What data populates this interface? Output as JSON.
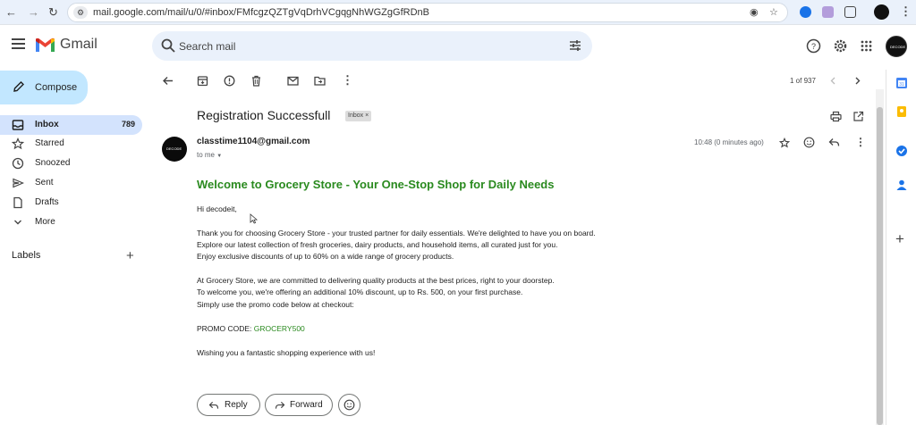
{
  "browser": {
    "url": "mail.google.com/mail/u/0/#inbox/FMfcgzQZTgVqDrhVCgqgNhWGZgGfRDnB"
  },
  "app": {
    "name": "Gmail"
  },
  "search": {
    "placeholder": "Search mail"
  },
  "compose": {
    "label": "Compose"
  },
  "sidebar": {
    "items": [
      {
        "label": "Inbox",
        "count": "789",
        "icon": "inbox-icon"
      },
      {
        "label": "Starred",
        "icon": "star-icon"
      },
      {
        "label": "Snoozed",
        "icon": "clock-icon"
      },
      {
        "label": "Sent",
        "icon": "send-icon"
      },
      {
        "label": "Drafts",
        "icon": "draft-icon"
      },
      {
        "label": "More",
        "icon": "chevron-down-icon"
      }
    ],
    "labels_heading": "Labels"
  },
  "toolbar": {
    "pager": "1 of 937"
  },
  "message": {
    "subject": "Registration Successfull",
    "label_chip": "Inbox ×",
    "avatar_text": "DECODE",
    "sender": "classtime1104@gmail.com",
    "to": "to me",
    "time": "10:48 (0 minutes ago)",
    "heading": "Welcome to Grocery Store - Your One-Stop Shop for Daily Needs",
    "greeting": "Hi decodeit,",
    "p1_l1": "Thank you for choosing Grocery Store - your trusted partner for daily essentials. We're delighted to have you on board.",
    "p1_l2": "Explore our latest collection of fresh groceries, dairy products, and household items, all curated just for you.",
    "p1_l3": "Enjoy exclusive discounts of up to 60% on a wide range of grocery products.",
    "p2_l1": "At Grocery Store, we are committed to delivering quality products at the best prices, right to your doorstep.",
    "p2_l2": "To welcome you, we're offering an additional 10% discount, up to Rs. 500, on your first purchase.",
    "p2_l3": "Simply use the promo code below at checkout:",
    "promo_label": "PROMO CODE: ",
    "promo_code": "GROCERY500",
    "closing": "Wishing you a fantastic shopping experience with us!"
  },
  "actions": {
    "reply": "Reply",
    "forward": "Forward"
  },
  "colors": {
    "accent": "#c2e7ff",
    "active_nav": "#d3e3fd",
    "heading_green": "#2a8a1f",
    "search_bg": "#eaf1fb"
  }
}
